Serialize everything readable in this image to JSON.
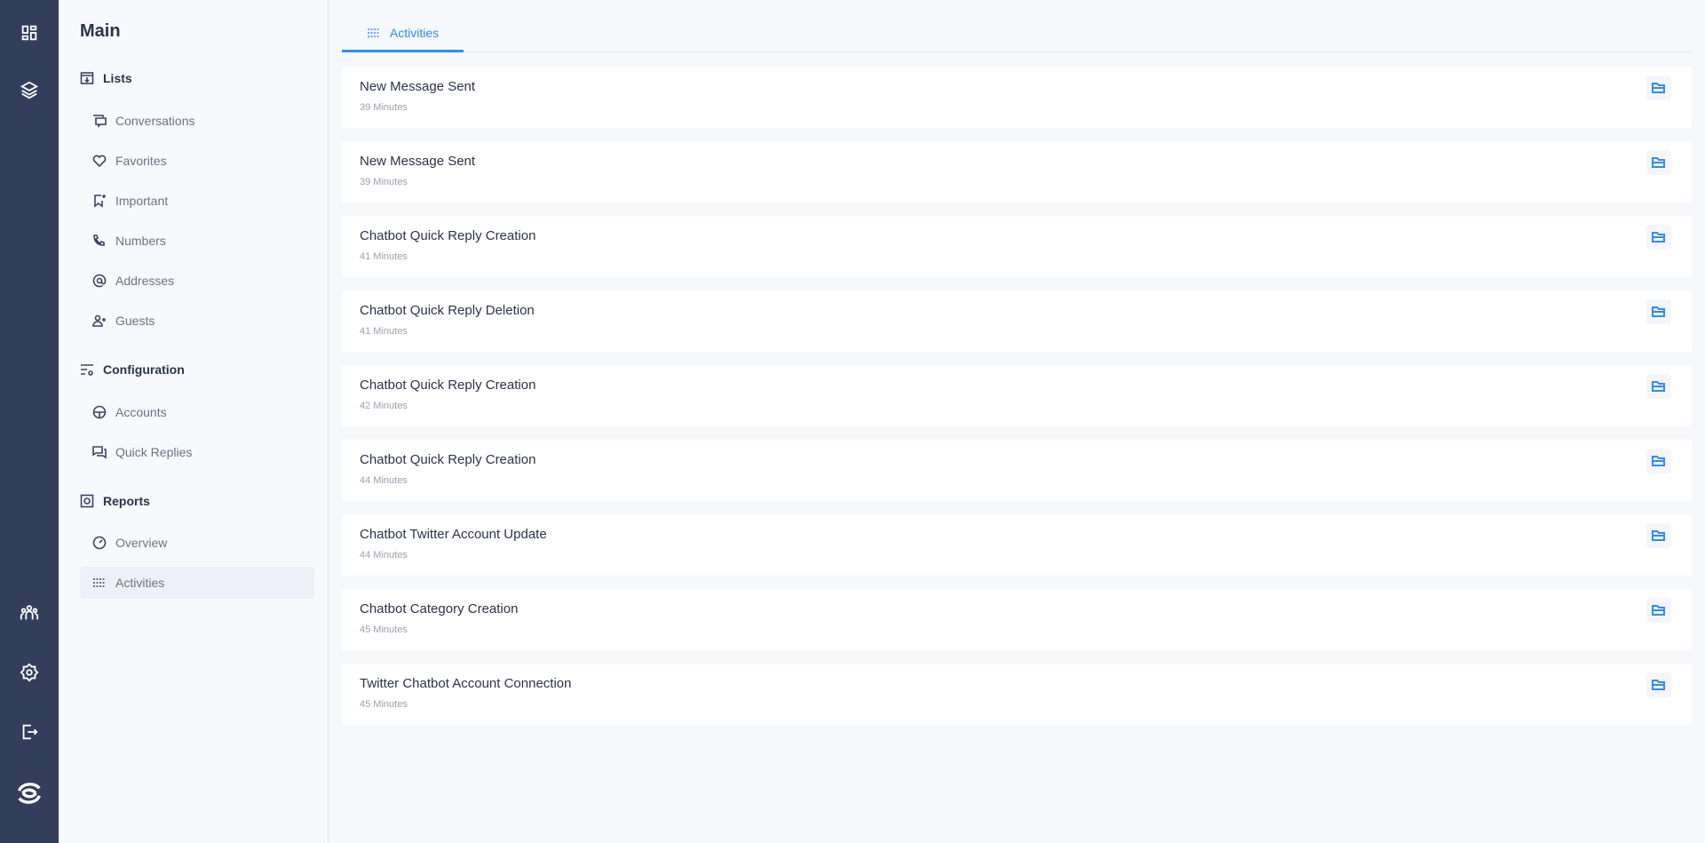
{
  "sidebar": {
    "title": "Main",
    "sections": [
      {
        "label": "Lists",
        "items": [
          "Conversations",
          "Favorites",
          "Important",
          "Numbers",
          "Addresses",
          "Guests"
        ]
      },
      {
        "label": "Configuration",
        "items": [
          "Accounts",
          "Quick Replies"
        ]
      },
      {
        "label": "Reports",
        "items": [
          "Overview",
          "Activities"
        ]
      }
    ],
    "active_item": "Activities"
  },
  "tab": {
    "label": "Activities"
  },
  "accent": "#2e8cf5",
  "activities": [
    {
      "title": "New Message Sent",
      "time": "39 Minutes"
    },
    {
      "title": "New Message Sent",
      "time": "39 Minutes"
    },
    {
      "title": "Chatbot Quick Reply Creation",
      "time": "41 Minutes"
    },
    {
      "title": "Chatbot Quick Reply Deletion",
      "time": "41 Minutes"
    },
    {
      "title": "Chatbot Quick Reply Creation",
      "time": "42 Minutes"
    },
    {
      "title": "Chatbot Quick Reply Creation",
      "time": "44 Minutes"
    },
    {
      "title": "Chatbot Twitter Account Update",
      "time": "44 Minutes"
    },
    {
      "title": "Chatbot Category Creation",
      "time": "45 Minutes"
    },
    {
      "title": "Twitter Chatbot Account Connection",
      "time": "45 Minutes"
    }
  ]
}
